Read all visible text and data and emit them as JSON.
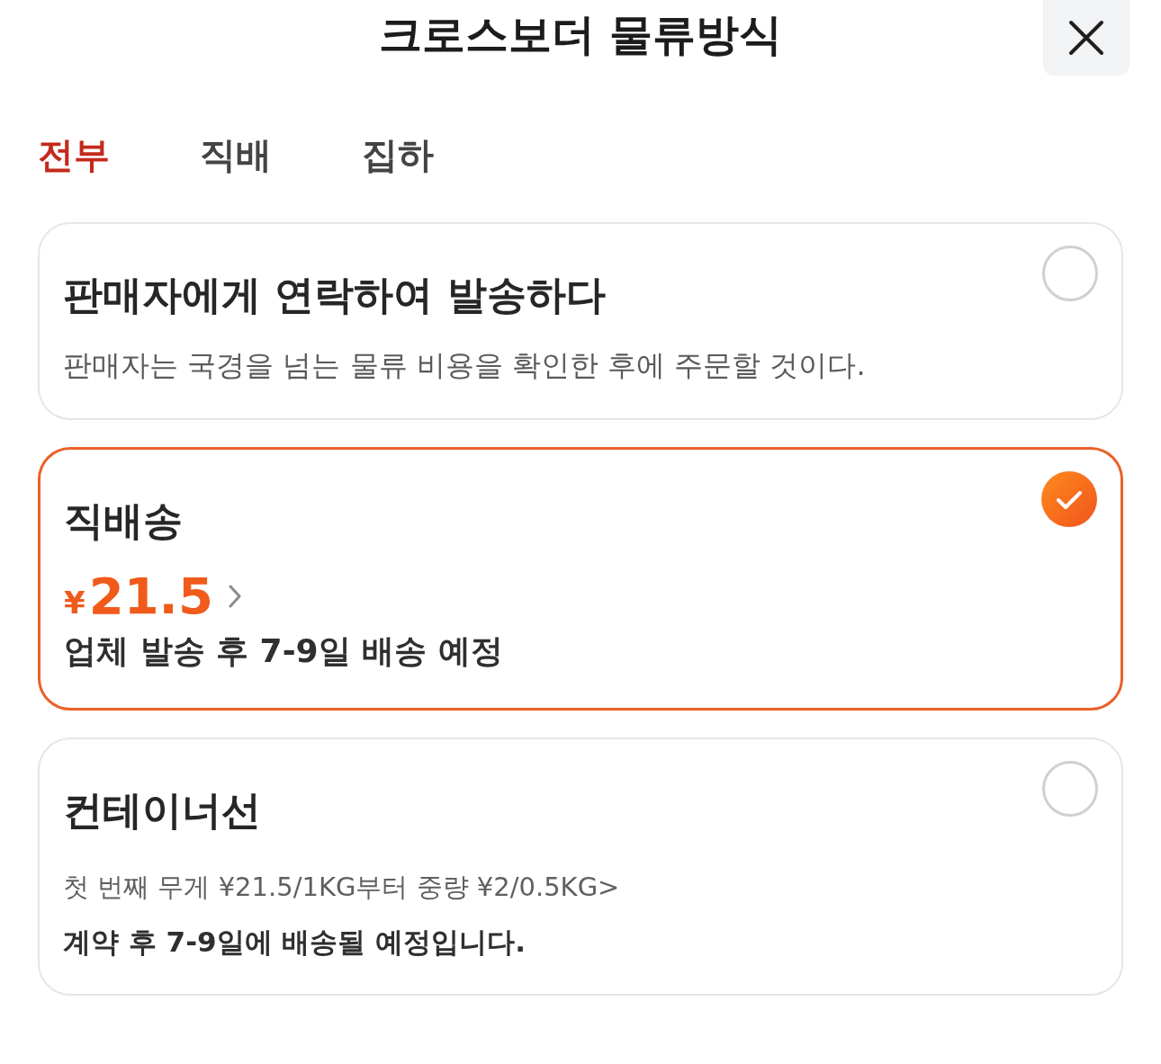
{
  "header": {
    "title": "크로스보더 물류방식"
  },
  "tabs": [
    {
      "label": "전부",
      "selected": true
    },
    {
      "label": "직배",
      "selected": false
    },
    {
      "label": "집하",
      "selected": false
    }
  ],
  "options": [
    {
      "title": "판매자에게 연락하여 발송하다",
      "selected": false,
      "details": [
        {
          "kind": "note",
          "text": "판매자는 국경을 넘는 물류 비용을 확인한 후에 주문할 것이다."
        }
      ]
    },
    {
      "title": "직배송",
      "selected": true,
      "details": [
        {
          "kind": "price",
          "currency": "¥",
          "amount": "21.5"
        },
        {
          "kind": "eta",
          "text": "업체 발송 후 7-9일 배송 예정"
        }
      ]
    },
    {
      "title": "컨테이너선",
      "selected": false,
      "details": [
        {
          "kind": "rate",
          "text": "첫 번째 무게 ¥21.5/1KG부터 중량 ¥2/0.5KG>"
        },
        {
          "kind": "eta_small",
          "text": "계약 후 7-9일에 배송될 예정입니다."
        }
      ]
    }
  ]
}
